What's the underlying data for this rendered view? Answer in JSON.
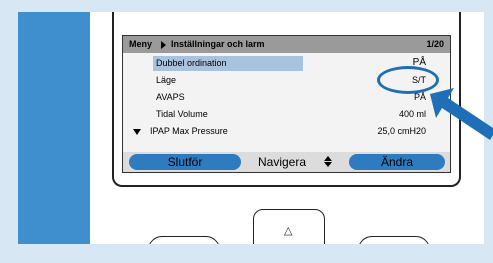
{
  "header": {
    "menu": "Meny",
    "path": "Inställningar och larm",
    "page": "1/20"
  },
  "rows": [
    {
      "label": "Dubbel ordination",
      "value": "PÅ"
    },
    {
      "label": "Läge",
      "value": "S/T"
    },
    {
      "label": "AVAPS",
      "value": "PÅ"
    },
    {
      "label": "Tidal Volume",
      "value": "400 ml"
    },
    {
      "label": "IPAP Max Pressure",
      "value": "25,0 cmH20"
    }
  ],
  "buttons": {
    "left": "Slutför",
    "center": "Navigera",
    "right": "Ändra"
  },
  "hardware": {
    "center_key_symbol": "△"
  },
  "colors": {
    "accent": "#2f7bc0",
    "panel": "#3f8fcf",
    "highlight": "#a8c4dc",
    "header": "#9a9a9a"
  },
  "icons": {
    "menu_separator": "triangle-right-icon",
    "scroll": "triangle-down-icon",
    "navigate": "up-down-arrows-icon",
    "pointer": "blue-arrow-icon"
  }
}
